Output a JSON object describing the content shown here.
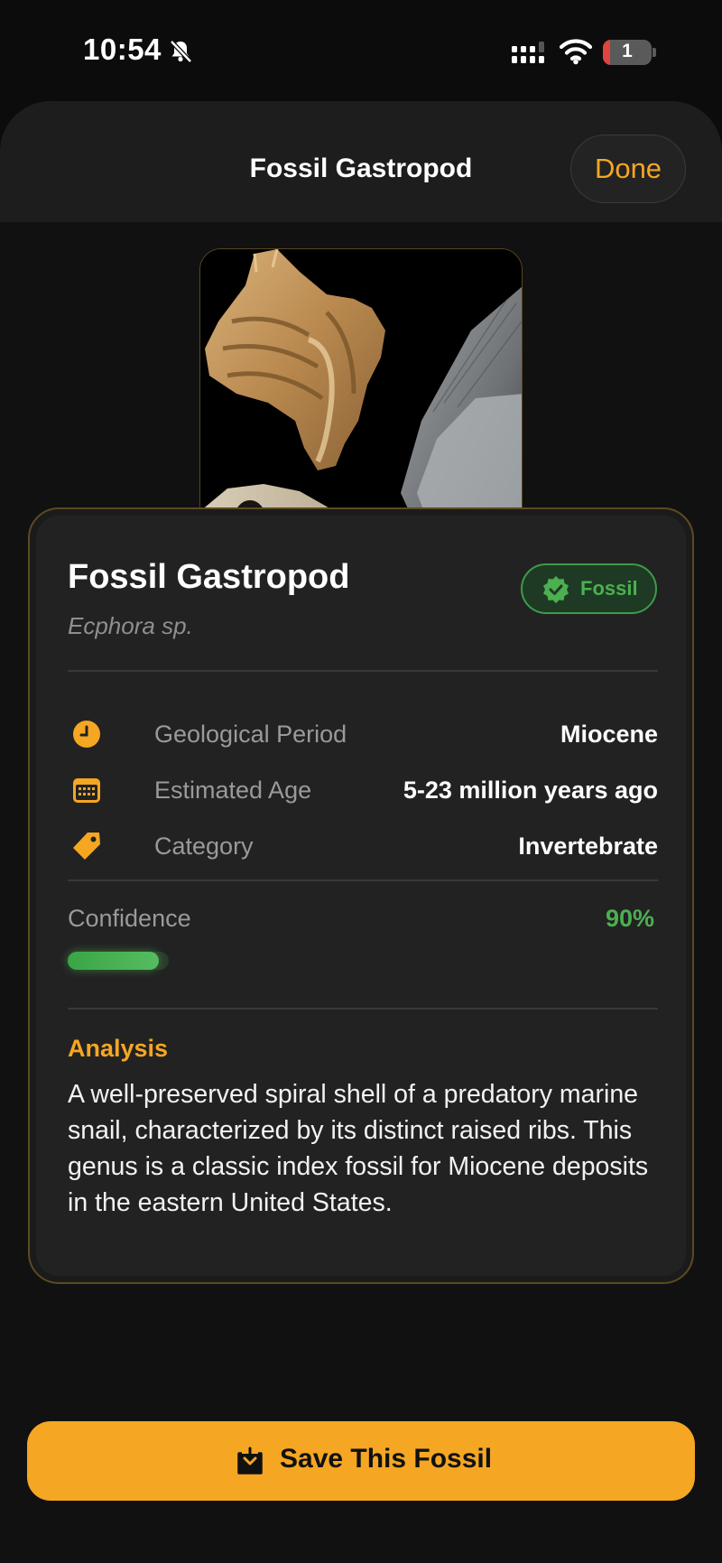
{
  "status_bar": {
    "time": "10:54",
    "battery_level": "1",
    "icons": [
      "bell-slash-icon",
      "cellular-signal-icon",
      "wifi-icon",
      "battery-icon"
    ]
  },
  "nav": {
    "title": "Fossil Gastropod",
    "done_label": "Done"
  },
  "photo": {
    "subject": "fossil collage: gastropod shell, shark tooth, skull"
  },
  "card": {
    "title": "Fossil Gastropod",
    "scientific_name": "Ecphora sp.",
    "badge": {
      "label": "Fossil",
      "icon": "verified-check-icon",
      "color": "#4caf50"
    },
    "details": [
      {
        "icon": "clock-icon",
        "label": "Geological Period",
        "value": "Miocene"
      },
      {
        "icon": "calendar-icon",
        "label": "Estimated Age",
        "value": "5-23 million years ago"
      },
      {
        "icon": "tag-icon",
        "label": "Category",
        "value": "Invertebrate"
      }
    ],
    "confidence": {
      "label": "Confidence",
      "value": "90%",
      "fraction": 0.9
    },
    "analysis": {
      "heading": "Analysis",
      "text": "A well-preserved spiral shell of a predatory marine snail, characterized by its distinct raised ribs. This genus is a classic index fossil for Miocene deposits in the eastern United States."
    }
  },
  "save_button": {
    "label": "Save This Fossil",
    "icon": "download-tray-icon"
  },
  "colors": {
    "accent": "#f5a623",
    "success": "#4caf50",
    "background": "#0c0c0c",
    "card": "#222222"
  }
}
